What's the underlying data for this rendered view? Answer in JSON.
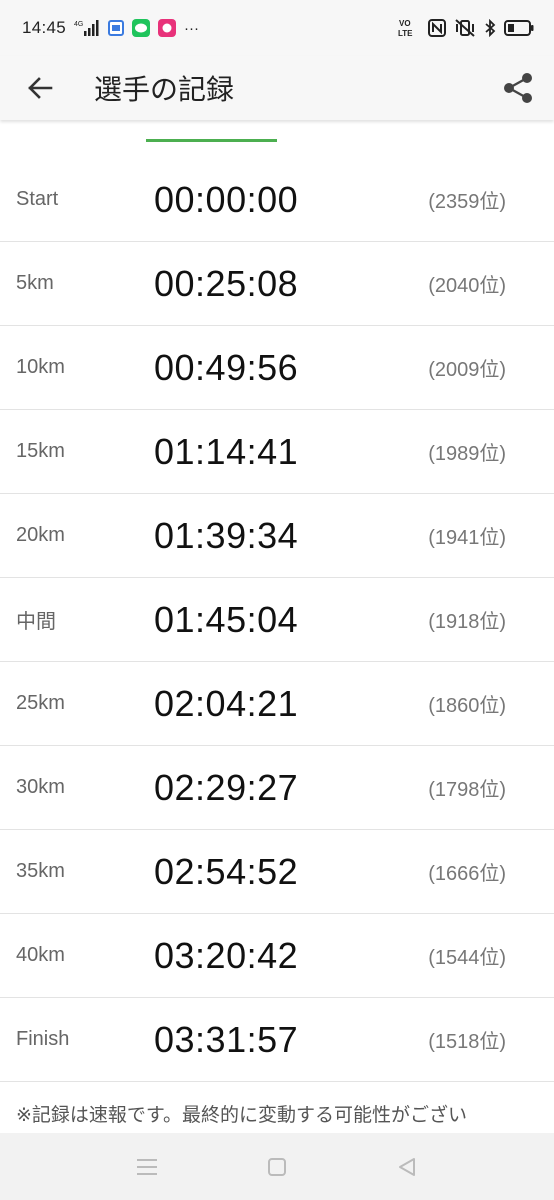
{
  "status_bar": {
    "time": "14:45",
    "network": "4G",
    "more": "···"
  },
  "app_bar": {
    "title": "選手の記録"
  },
  "records": [
    {
      "point": "Start",
      "time": "00:00:00",
      "rank": "(2359位)"
    },
    {
      "point": "5km",
      "time": "00:25:08",
      "rank": "(2040位)"
    },
    {
      "point": "10km",
      "time": "00:49:56",
      "rank": "(2009位)"
    },
    {
      "point": "15km",
      "time": "01:14:41",
      "rank": "(1989位)"
    },
    {
      "point": "20km",
      "time": "01:39:34",
      "rank": "(1941位)"
    },
    {
      "point": "中間",
      "time": "01:45:04",
      "rank": "(1918位)"
    },
    {
      "point": "25km",
      "time": "02:04:21",
      "rank": "(1860位)"
    },
    {
      "point": "30km",
      "time": "02:29:27",
      "rank": "(1798位)"
    },
    {
      "point": "35km",
      "time": "02:54:52",
      "rank": "(1666位)"
    },
    {
      "point": "40km",
      "time": "03:20:42",
      "rank": "(1544位)"
    },
    {
      "point": "Finish",
      "time": "03:31:57",
      "rank": "(1518位)"
    }
  ],
  "note": "※記録は速報です。最終的に変動する可能性がござい",
  "colors": {
    "accent": "#4caf50",
    "bar_bg": "#f7f7f7"
  },
  "icons": {
    "back": "arrow-left-icon",
    "share": "share-icon",
    "nav_menu": "menu-icon",
    "nav_home": "home-icon",
    "nav_back": "triangle-back-icon"
  }
}
